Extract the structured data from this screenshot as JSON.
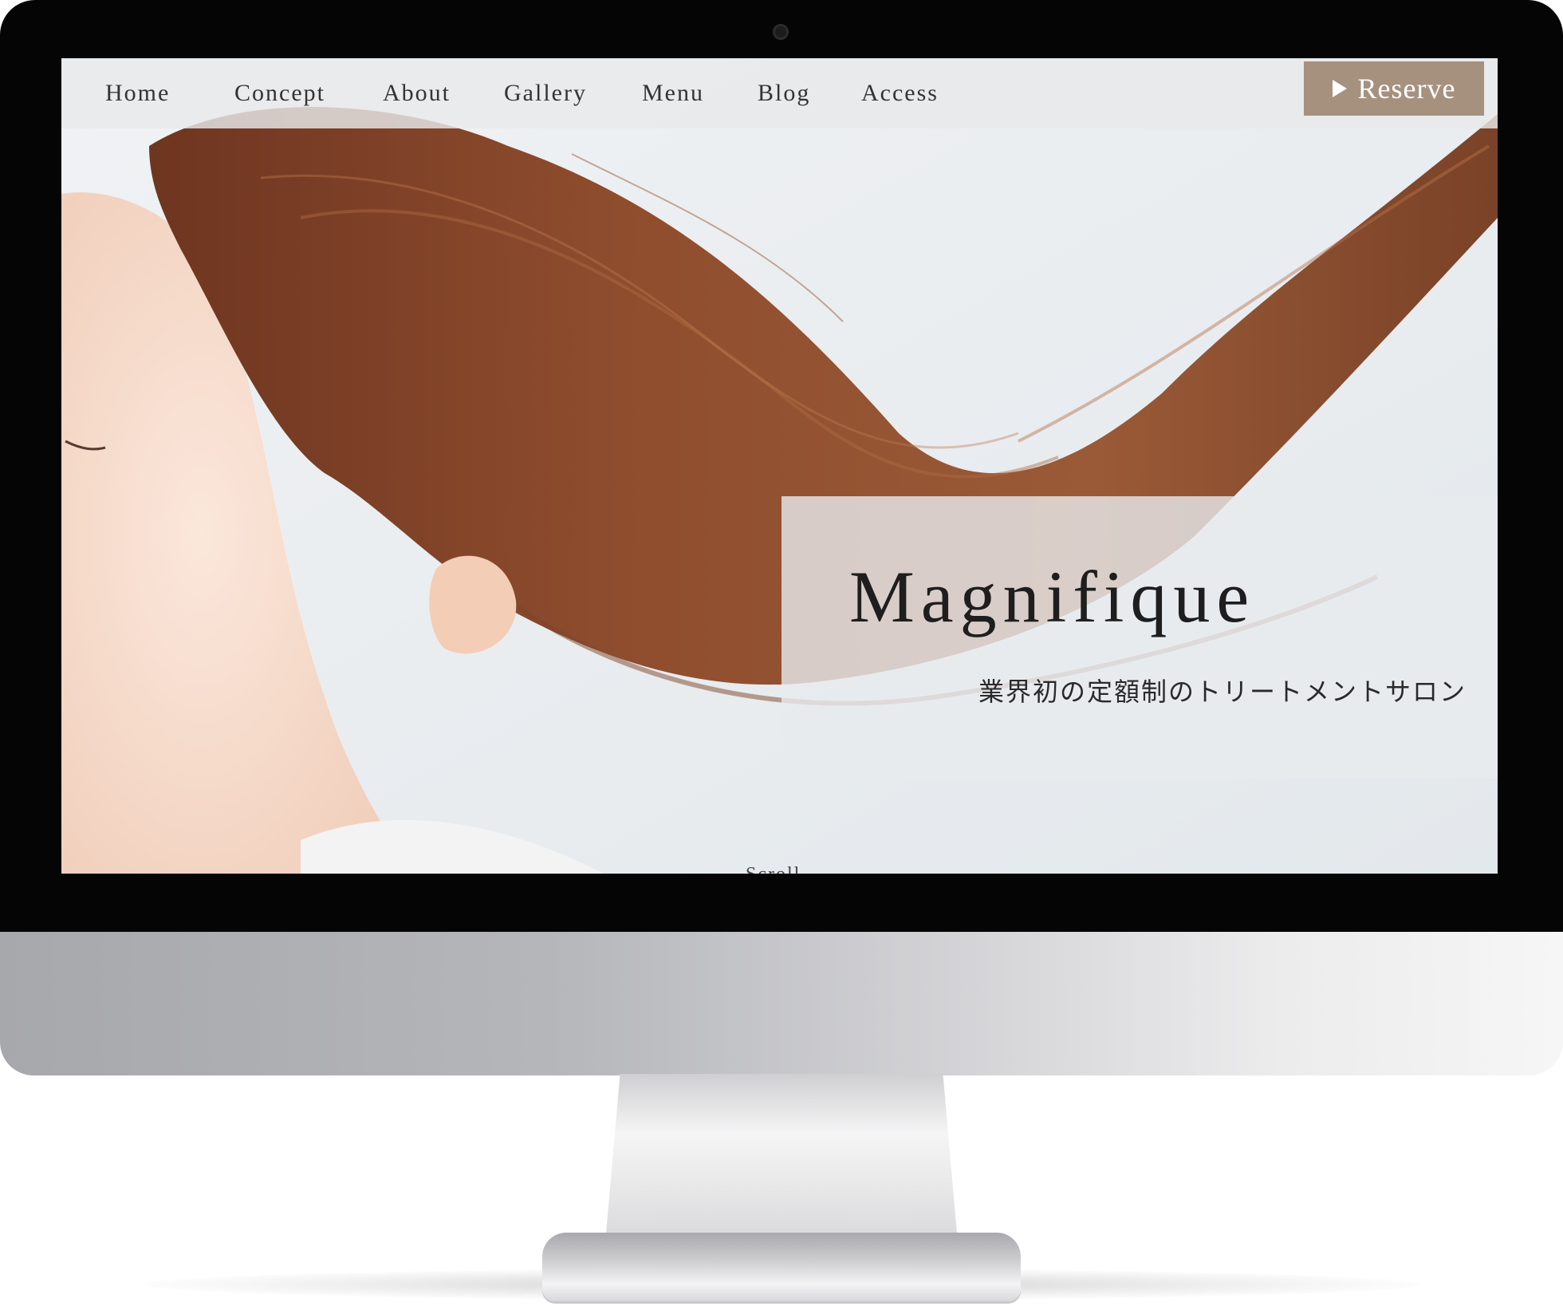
{
  "nav": {
    "items": [
      {
        "label": "Home"
      },
      {
        "label": "Concept"
      },
      {
        "label": "About"
      },
      {
        "label": "Gallery"
      },
      {
        "label": "Menu"
      },
      {
        "label": "Blog"
      },
      {
        "label": "Access"
      }
    ],
    "reserve_label": "Reserve",
    "reserve_icon": "play-icon"
  },
  "hero": {
    "title": "Magnifique",
    "tagline": "業界初の定額制のトリートメントサロン",
    "scroll_label": "Scroll"
  },
  "colors": {
    "reserve_button": "#a6917f",
    "bezel": "#050505",
    "hair": "#8a4a2c"
  }
}
